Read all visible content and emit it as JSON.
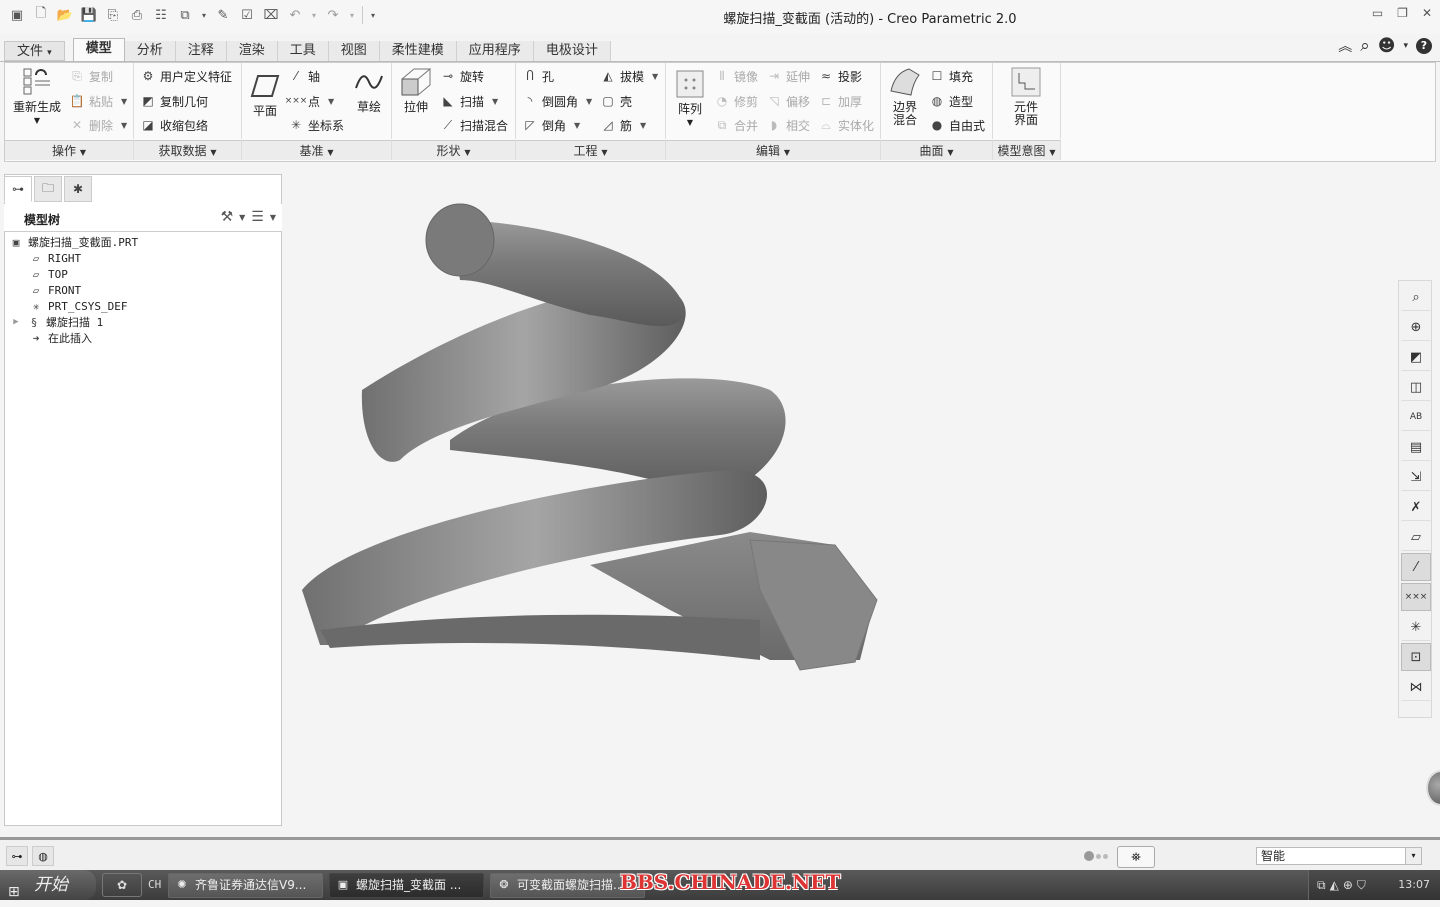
{
  "window": {
    "title": "螺旋扫描_变截面 (活动的) - Creo Parametric 2.0",
    "controls": {
      "minimize": "▭",
      "restore": "❐",
      "close": "✕"
    }
  },
  "quick_access": [
    "window-icon",
    "new-icon",
    "open-icon",
    "save-icon",
    "save-copy-icon",
    "backup-icon",
    "regenerate-icon",
    "windows-icon",
    "edit-icon",
    "verify-icon",
    "close-window-icon",
    "undo-icon",
    "redo-icon",
    "customize-icon"
  ],
  "ribbon_tabs": [
    {
      "label": "文件",
      "dropdown": "▾"
    },
    {
      "label": "模型",
      "active": true
    },
    {
      "label": "分析"
    },
    {
      "label": "注释"
    },
    {
      "label": "渲染"
    },
    {
      "label": "工具"
    },
    {
      "label": "视图"
    },
    {
      "label": "柔性建模"
    },
    {
      "label": "应用程序"
    },
    {
      "label": "电极设计"
    }
  ],
  "ribbon_right": {
    "collapse": "︽",
    "search": "⌕",
    "community": "☻",
    "dropdown": "▾",
    "help": "?"
  },
  "ribbon": {
    "operations": {
      "label": "操作",
      "regenerate": "重新生成",
      "copy": "复制",
      "paste": "粘贴",
      "delete": "删除"
    },
    "get_data": {
      "label": "获取数据",
      "udf": "用户定义特征",
      "copy_geom": "复制几何",
      "shrinkwrap": "收缩包络"
    },
    "datum": {
      "label": "基准",
      "plane": "平面",
      "axis": "轴",
      "point": "点",
      "csys": "坐标系",
      "sketch": "草绘"
    },
    "shapes": {
      "label": "形状",
      "extrude": "拉伸",
      "revolve": "旋转",
      "sweep": "扫描",
      "swept_blend": "扫描混合"
    },
    "engineering": {
      "label": "工程",
      "hole": "孔",
      "round": "倒圆角",
      "chamfer": "倒角",
      "draft": "拔模",
      "shell": "壳",
      "rib": "筋",
      "pattern": "阵列"
    },
    "editing": {
      "label": "编辑",
      "mirror": "镜像",
      "trim": "修剪",
      "merge": "合并",
      "extend": "延伸",
      "offset": "偏移",
      "intersect": "相交",
      "project": "投影",
      "thicken": "加厚",
      "solidify": "实体化"
    },
    "surfaces": {
      "label": "曲面",
      "boundary_blend_1": "边界",
      "boundary_blend_2": "混合",
      "fill": "填充",
      "style": "造型",
      "freestyle": "自由式"
    },
    "model_intent": {
      "label": "模型意图",
      "component_interface_1": "元件",
      "component_interface_2": "界面"
    }
  },
  "model_tree": {
    "header": "模型树",
    "items": [
      {
        "label": "螺旋扫描_变截面.PRT",
        "icon": "part-icon"
      },
      {
        "label": "RIGHT",
        "icon": "datum-plane-icon"
      },
      {
        "label": "TOP",
        "icon": "datum-plane-icon"
      },
      {
        "label": "FRONT",
        "icon": "datum-plane-icon"
      },
      {
        "label": "PRT_CSYS_DEF",
        "icon": "csys-icon"
      },
      {
        "label": "螺旋扫描 1",
        "icon": "helical-sweep-icon",
        "expandable": true
      },
      {
        "label": "在此插入",
        "icon": "insert-here-arrow-icon"
      }
    ]
  },
  "graphics_toolbar": [
    "refit-icon",
    "zoom-in-icon",
    "repaint-icon",
    "display-style-icon",
    "saved-orientations-icon",
    "view-manager-icon",
    "perspective-icon",
    "spin-center-icon",
    "plane-display-icon",
    "axis-display-icon",
    "point-display-icon",
    "csys-display-icon",
    "annotation-display-icon",
    "graph-icon"
  ],
  "graphics_toolbar_active": [
    9,
    10,
    12
  ],
  "status": {
    "filter_value": "智能",
    "filter_arrow": "▾"
  },
  "taskbar": {
    "start": "开始",
    "lang": "CH",
    "items": [
      {
        "label": "齐鲁证券通达信V9..."
      },
      {
        "label": "螺旋扫描_变截面 ...",
        "active": true
      },
      {
        "label": "可变截面螺旋扫描..."
      }
    ],
    "clock": "13:07"
  },
  "watermark": "BBS.CHINADE.NET"
}
